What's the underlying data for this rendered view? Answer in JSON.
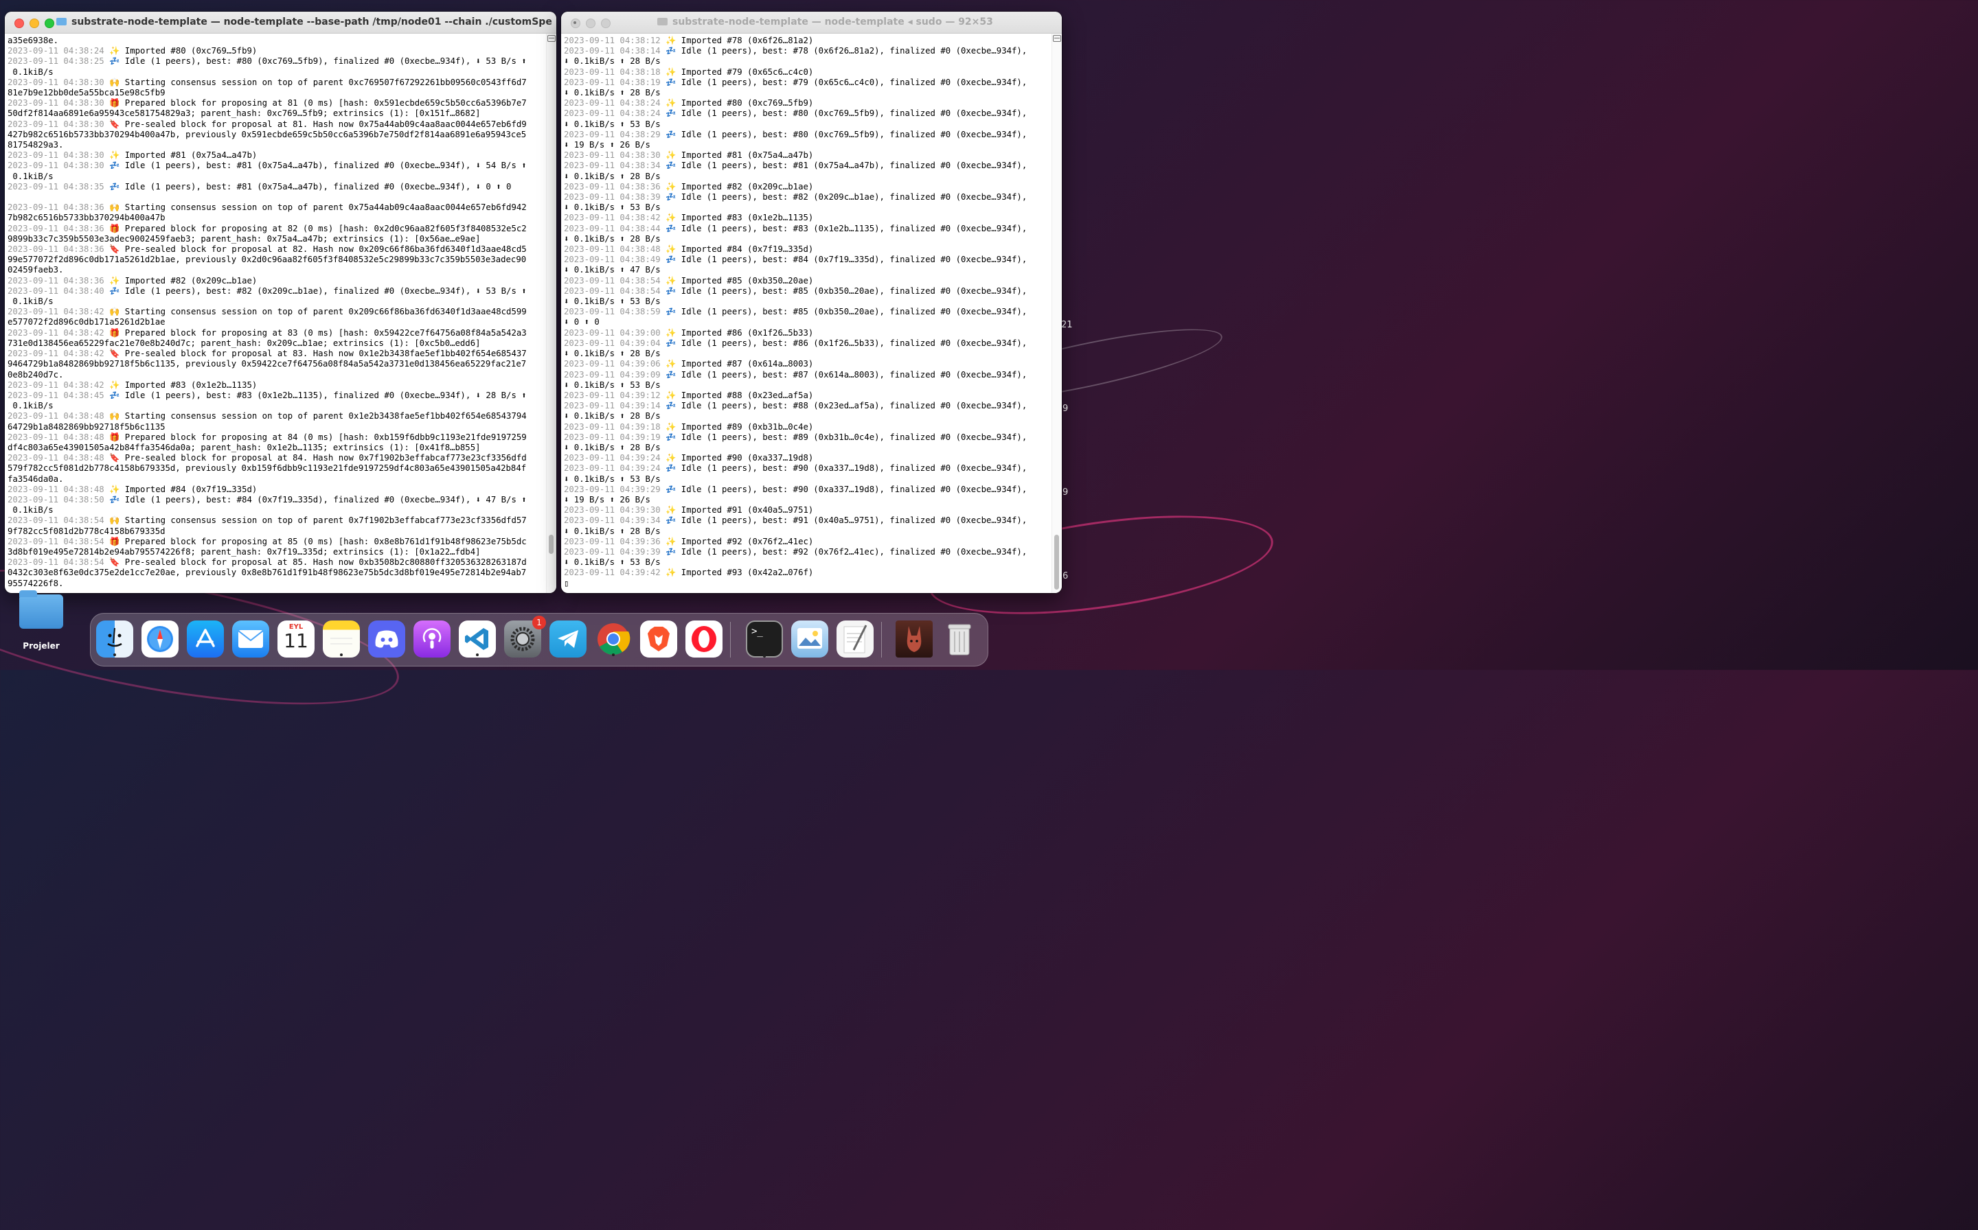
{
  "desktop": {
    "folder_label": "Projeler",
    "edge_labels": [
      "21",
      "9",
      "9",
      "6"
    ]
  },
  "left_window": {
    "title": "substrate-node-template — node-template --base-path /tmp/node01 --chain ./customSpecRaw.json...",
    "lines": [
      [
        "",
        "a35e6938e."
      ],
      [
        "2023-09-11 04:38:24",
        "✨ Imported #80 (0xc769…5fb9)"
      ],
      [
        "2023-09-11 04:38:25",
        "💤 Idle (1 peers), best: #80 (0xc769…5fb9), finalized #0 (0xecbe…934f), ⬇ 53 B/s ⬆"
      ],
      [
        "",
        " 0.1kiB/s"
      ],
      [
        "2023-09-11 04:38:30",
        "🙌 Starting consensus session on top of parent 0xc769507f67292261bb09560c0543ff6d7"
      ],
      [
        "",
        "81e7b9e12bb0de5a55bca15e98c5fb9"
      ],
      [
        "2023-09-11 04:38:30",
        "🎁 Prepared block for proposing at 81 (0 ms) [hash: 0x591ecbde659c5b50cc6a5396b7e7"
      ],
      [
        "",
        "50df2f814aa6891e6a95943ce581754829a3; parent_hash: 0xc769…5fb9; extrinsics (1): [0x151f…8682]"
      ],
      [
        "2023-09-11 04:38:30",
        "🔖 Pre-sealed block for proposal at 81. Hash now 0x75a44ab09c4aa8aac0044e657eb6fd9"
      ],
      [
        "",
        "427b982c6516b5733bb370294b400a47b, previously 0x591ecbde659c5b50cc6a5396b7e750df2f814aa6891e6a95943ce5"
      ],
      [
        "",
        "81754829a3."
      ],
      [
        "2023-09-11 04:38:30",
        "✨ Imported #81 (0x75a4…a47b)"
      ],
      [
        "2023-09-11 04:38:30",
        "💤 Idle (1 peers), best: #81 (0x75a4…a47b), finalized #0 (0xecbe…934f), ⬇ 54 B/s ⬆"
      ],
      [
        "",
        " 0.1kiB/s"
      ],
      [
        "2023-09-11 04:38:35",
        "💤 Idle (1 peers), best: #81 (0x75a4…a47b), finalized #0 (0xecbe…934f), ⬇ 0 ⬆ 0"
      ],
      [
        "",
        ""
      ],
      [
        "2023-09-11 04:38:36",
        "🙌 Starting consensus session on top of parent 0x75a44ab09c4aa8aac0044e657eb6fd942"
      ],
      [
        "",
        "7b982c6516b5733bb370294b400a47b"
      ],
      [
        "2023-09-11 04:38:36",
        "🎁 Prepared block for proposing at 82 (0 ms) [hash: 0x2d0c96aa82f605f3f8408532e5c2"
      ],
      [
        "",
        "9899b33c7c359b5503e3adec9002459faeb3; parent_hash: 0x75a4…a47b; extrinsics (1): [0x56ae…e9ae]"
      ],
      [
        "2023-09-11 04:38:36",
        "🔖 Pre-sealed block for proposal at 82. Hash now 0x209c66f86ba36fd6340f1d3aae48cd5"
      ],
      [
        "",
        "99e577072f2d896c0db171a5261d2b1ae, previously 0x2d0c96aa82f605f3f8408532e5c29899b33c7c359b5503e3adec90"
      ],
      [
        "",
        "02459faeb3."
      ],
      [
        "2023-09-11 04:38:36",
        "✨ Imported #82 (0x209c…b1ae)"
      ],
      [
        "2023-09-11 04:38:40",
        "💤 Idle (1 peers), best: #82 (0x209c…b1ae), finalized #0 (0xecbe…934f), ⬇ 53 B/s ⬆"
      ],
      [
        "",
        " 0.1kiB/s"
      ],
      [
        "2023-09-11 04:38:42",
        "🙌 Starting consensus session on top of parent 0x209c66f86ba36fd6340f1d3aae48cd599"
      ],
      [
        "",
        "e577072f2d896c0db171a5261d2b1ae"
      ],
      [
        "2023-09-11 04:38:42",
        "🎁 Prepared block for proposing at 83 (0 ms) [hash: 0x59422ce7f64756a08f84a5a542a3"
      ],
      [
        "",
        "731e0d138456ea65229fac21e70e8b240d7c; parent_hash: 0x209c…b1ae; extrinsics (1): [0xc5b0…edd6]"
      ],
      [
        "2023-09-11 04:38:42",
        "🔖 Pre-sealed block for proposal at 83. Hash now 0x1e2b3438fae5ef1bb402f654e685437"
      ],
      [
        "",
        "9464729b1a8482869bb92718f5b6c1135, previously 0x59422ce7f64756a08f84a5a542a3731e0d138456ea65229fac21e7"
      ],
      [
        "",
        "0e8b240d7c."
      ],
      [
        "2023-09-11 04:38:42",
        "✨ Imported #83 (0x1e2b…1135)"
      ],
      [
        "2023-09-11 04:38:45",
        "💤 Idle (1 peers), best: #83 (0x1e2b…1135), finalized #0 (0xecbe…934f), ⬇ 28 B/s ⬆"
      ],
      [
        "",
        " 0.1kiB/s"
      ],
      [
        "2023-09-11 04:38:48",
        "🙌 Starting consensus session on top of parent 0x1e2b3438fae5ef1bb402f654e68543794"
      ],
      [
        "",
        "64729b1a8482869bb92718f5b6c1135"
      ],
      [
        "2023-09-11 04:38:48",
        "🎁 Prepared block for proposing at 84 (0 ms) [hash: 0xb159f6dbb9c1193e21fde9197259"
      ],
      [
        "",
        "df4c803a65e43901505a42b84ffa3546da0a; parent_hash: 0x1e2b…1135; extrinsics (1): [0x41f8…b855]"
      ],
      [
        "2023-09-11 04:38:48",
        "🔖 Pre-sealed block for proposal at 84. Hash now 0x7f1902b3effabcaf773e23cf3356dfd"
      ],
      [
        "",
        "579f782cc5f081d2b778c4158b679335d, previously 0xb159f6dbb9c1193e21fde9197259df4c803a65e43901505a42b84f"
      ],
      [
        "",
        "fa3546da0a."
      ],
      [
        "2023-09-11 04:38:48",
        "✨ Imported #84 (0x7f19…335d)"
      ],
      [
        "2023-09-11 04:38:50",
        "💤 Idle (1 peers), best: #84 (0x7f19…335d), finalized #0 (0xecbe…934f), ⬇ 47 B/s ⬆"
      ],
      [
        "",
        " 0.1kiB/s"
      ],
      [
        "2023-09-11 04:38:54",
        "🙌 Starting consensus session on top of parent 0x7f1902b3effabcaf773e23cf3356dfd57"
      ],
      [
        "",
        "9f782cc5f081d2b778c4158b679335d"
      ],
      [
        "2023-09-11 04:38:54",
        "🎁 Prepared block for proposing at 85 (0 ms) [hash: 0x8e8b761d1f91b48f98623e75b5dc"
      ],
      [
        "",
        "3d8bf019e495e72814b2e94ab795574226f8; parent_hash: 0x7f19…335d; extrinsics (1): [0x1a22…fdb4]"
      ],
      [
        "2023-09-11 04:38:54",
        "🔖 Pre-sealed block for proposal at 85. Hash now 0xb3508b2c80880ff320536328263187d"
      ],
      [
        "",
        "0432c303e8f63e0dc375e2de1cc7e20ae, previously 0x8e8b761d1f91b48f98623e75b5dc3d8bf019e495e72814b2e94ab7"
      ],
      [
        "",
        "95574226f8."
      ]
    ]
  },
  "right_window": {
    "title": "substrate-node-template — node-template ◂ sudo — 92×53",
    "lines": [
      [
        "2023-09-11 04:38:12",
        "✨ Imported #78 (0x6f26…81a2)"
      ],
      [
        "2023-09-11 04:38:14",
        "💤 Idle (1 peers), best: #78 (0x6f26…81a2), finalized #0 (0xecbe…934f),"
      ],
      [
        "",
        "⬇ 0.1kiB/s ⬆ 28 B/s"
      ],
      [
        "2023-09-11 04:38:18",
        "✨ Imported #79 (0x65c6…c4c0)"
      ],
      [
        "2023-09-11 04:38:19",
        "💤 Idle (1 peers), best: #79 (0x65c6…c4c0), finalized #0 (0xecbe…934f),"
      ],
      [
        "",
        "⬇ 0.1kiB/s ⬆ 28 B/s"
      ],
      [
        "2023-09-11 04:38:24",
        "✨ Imported #80 (0xc769…5fb9)"
      ],
      [
        "2023-09-11 04:38:24",
        "💤 Idle (1 peers), best: #80 (0xc769…5fb9), finalized #0 (0xecbe…934f),"
      ],
      [
        "",
        "⬇ 0.1kiB/s ⬆ 53 B/s"
      ],
      [
        "2023-09-11 04:38:29",
        "💤 Idle (1 peers), best: #80 (0xc769…5fb9), finalized #0 (0xecbe…934f),"
      ],
      [
        "",
        "⬇ 19 B/s ⬆ 26 B/s"
      ],
      [
        "2023-09-11 04:38:30",
        "✨ Imported #81 (0x75a4…a47b)"
      ],
      [
        "2023-09-11 04:38:34",
        "💤 Idle (1 peers), best: #81 (0x75a4…a47b), finalized #0 (0xecbe…934f),"
      ],
      [
        "",
        "⬇ 0.1kiB/s ⬆ 28 B/s"
      ],
      [
        "2023-09-11 04:38:36",
        "✨ Imported #82 (0x209c…b1ae)"
      ],
      [
        "2023-09-11 04:38:39",
        "💤 Idle (1 peers), best: #82 (0x209c…b1ae), finalized #0 (0xecbe…934f),"
      ],
      [
        "",
        "⬇ 0.1kiB/s ⬆ 53 B/s"
      ],
      [
        "2023-09-11 04:38:42",
        "✨ Imported #83 (0x1e2b…1135)"
      ],
      [
        "2023-09-11 04:38:44",
        "💤 Idle (1 peers), best: #83 (0x1e2b…1135), finalized #0 (0xecbe…934f),"
      ],
      [
        "",
        "⬇ 0.1kiB/s ⬆ 28 B/s"
      ],
      [
        "2023-09-11 04:38:48",
        "✨ Imported #84 (0x7f19…335d)"
      ],
      [
        "2023-09-11 04:38:49",
        "💤 Idle (1 peers), best: #84 (0x7f19…335d), finalized #0 (0xecbe…934f),"
      ],
      [
        "",
        "⬇ 0.1kiB/s ⬆ 47 B/s"
      ],
      [
        "2023-09-11 04:38:54",
        "✨ Imported #85 (0xb350…20ae)"
      ],
      [
        "2023-09-11 04:38:54",
        "💤 Idle (1 peers), best: #85 (0xb350…20ae), finalized #0 (0xecbe…934f),"
      ],
      [
        "",
        "⬇ 0.1kiB/s ⬆ 53 B/s"
      ],
      [
        "2023-09-11 04:38:59",
        "💤 Idle (1 peers), best: #85 (0xb350…20ae), finalized #0 (0xecbe…934f),"
      ],
      [
        "",
        "⬇ 0 ⬆ 0"
      ],
      [
        "2023-09-11 04:39:00",
        "✨ Imported #86 (0x1f26…5b33)"
      ],
      [
        "2023-09-11 04:39:04",
        "💤 Idle (1 peers), best: #86 (0x1f26…5b33), finalized #0 (0xecbe…934f),"
      ],
      [
        "",
        "⬇ 0.1kiB/s ⬆ 28 B/s"
      ],
      [
        "2023-09-11 04:39:06",
        "✨ Imported #87 (0x614a…8003)"
      ],
      [
        "2023-09-11 04:39:09",
        "💤 Idle (1 peers), best: #87 (0x614a…8003), finalized #0 (0xecbe…934f),"
      ],
      [
        "",
        "⬇ 0.1kiB/s ⬆ 53 B/s"
      ],
      [
        "2023-09-11 04:39:12",
        "✨ Imported #88 (0x23ed…af5a)"
      ],
      [
        "2023-09-11 04:39:14",
        "💤 Idle (1 peers), best: #88 (0x23ed…af5a), finalized #0 (0xecbe…934f),"
      ],
      [
        "",
        "⬇ 0.1kiB/s ⬆ 28 B/s"
      ],
      [
        "2023-09-11 04:39:18",
        "✨ Imported #89 (0xb31b…0c4e)"
      ],
      [
        "2023-09-11 04:39:19",
        "💤 Idle (1 peers), best: #89 (0xb31b…0c4e), finalized #0 (0xecbe…934f),"
      ],
      [
        "",
        "⬇ 0.1kiB/s ⬆ 28 B/s"
      ],
      [
        "2023-09-11 04:39:24",
        "✨ Imported #90 (0xa337…19d8)"
      ],
      [
        "2023-09-11 04:39:24",
        "💤 Idle (1 peers), best: #90 (0xa337…19d8), finalized #0 (0xecbe…934f),"
      ],
      [
        "",
        "⬇ 0.1kiB/s ⬆ 53 B/s"
      ],
      [
        "2023-09-11 04:39:29",
        "💤 Idle (1 peers), best: #90 (0xa337…19d8), finalized #0 (0xecbe…934f),"
      ],
      [
        "",
        "⬇ 19 B/s ⬆ 26 B/s"
      ],
      [
        "2023-09-11 04:39:30",
        "✨ Imported #91 (0x40a5…9751)"
      ],
      [
        "2023-09-11 04:39:34",
        "💤 Idle (1 peers), best: #91 (0x40a5…9751), finalized #0 (0xecbe…934f),"
      ],
      [
        "",
        "⬇ 0.1kiB/s ⬆ 28 B/s"
      ],
      [
        "2023-09-11 04:39:36",
        "✨ Imported #92 (0x76f2…41ec)"
      ],
      [
        "2023-09-11 04:39:39",
        "💤 Idle (1 peers), best: #92 (0x76f2…41ec), finalized #0 (0xecbe…934f),"
      ],
      [
        "",
        "⬇ 0.1kiB/s ⬆ 53 B/s"
      ],
      [
        "2023-09-11 04:39:42",
        "✨ Imported #93 (0x42a2…076f)"
      ],
      [
        "",
        "▯"
      ]
    ]
  },
  "dock": {
    "calendar_month": "EYL",
    "calendar_day": "11",
    "settings_badge": "1",
    "terminal_prompt": ">_",
    "apps": [
      "finder-icon",
      "safari-icon",
      "app-store-icon",
      "mail-icon",
      "calendar-icon",
      "notes-icon",
      "discord-icon",
      "podcasts-icon",
      "vscode-icon",
      "system-settings-icon",
      "telegram-icon",
      "chrome-icon",
      "brave-icon",
      "opera-icon",
      "terminal-icon",
      "preview-icon",
      "textedit-icon",
      "photo-icon",
      "trash-icon"
    ]
  }
}
